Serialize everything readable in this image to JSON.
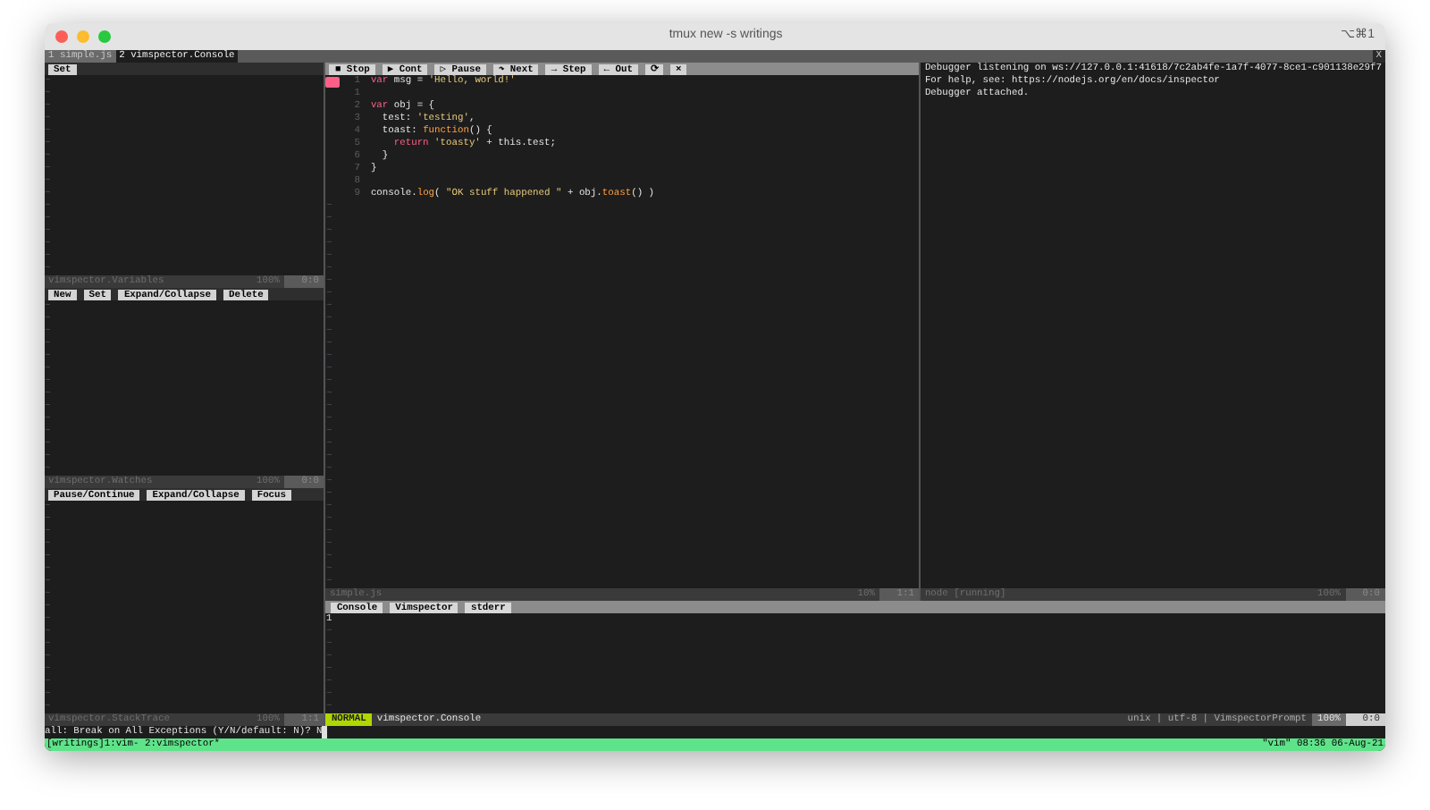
{
  "window": {
    "title": "tmux new -s writings",
    "shortcut": "⌥⌘1"
  },
  "vim_tabs": [
    {
      "label": "1 simple.js",
      "selected": false
    },
    {
      "label": "2 vimspector.Console",
      "selected": true
    }
  ],
  "tabline_close": "X",
  "left_panes": [
    {
      "toolbar": [
        "Set"
      ],
      "empty_lines": [
        "~",
        "~",
        "~",
        "~",
        "~",
        "~",
        "~",
        "~",
        "~",
        "~",
        "~",
        "~",
        "~",
        "~",
        "~",
        "~"
      ],
      "status": {
        "name": "vimspector.Variables",
        "percent": "100%",
        "position": "0:0"
      }
    },
    {
      "toolbar": [
        "New",
        "Set",
        "Expand/Collapse",
        "Delete"
      ],
      "empty_lines": [
        "~",
        "~",
        "~",
        "~",
        "~",
        "~",
        "~",
        "~",
        "~",
        "~",
        "~",
        "~",
        "~",
        "~"
      ],
      "status": {
        "name": "vimspector.Watches",
        "percent": "100%",
        "position": "0:0"
      }
    },
    {
      "toolbar": [
        "Pause/Continue",
        "Expand/Collapse",
        "Focus"
      ],
      "empty_lines": [
        "~",
        "~",
        "~",
        "~",
        "~",
        "~",
        "~",
        "~",
        "~",
        "~",
        "~",
        "~",
        "~",
        "~",
        "~",
        "~",
        "~"
      ],
      "status": {
        "name": "vimspector.StackTrace",
        "percent": "100%",
        "position": "1:1"
      }
    }
  ],
  "code_pane": {
    "toolbar": [
      "■ Stop",
      "▶ Cont",
      "▷ Pause",
      "↷ Next",
      "→ Step",
      "← Out",
      "⟳",
      "×"
    ],
    "lines": [
      {
        "number": "1",
        "current": true,
        "tokens": [
          {
            "kind": "keyword",
            "text": "var"
          },
          {
            "kind": "plain",
            "text": " msg = "
          },
          {
            "kind": "string",
            "text": "'Hello, world!'"
          }
        ]
      },
      {
        "number": "1",
        "current": false
      },
      {
        "number": "2",
        "current": false,
        "tokens": [
          {
            "kind": "keyword",
            "text": "var"
          },
          {
            "kind": "plain",
            "text": " obj = {"
          }
        ]
      },
      {
        "number": "3",
        "current": false,
        "tokens": [
          {
            "kind": "plain",
            "text": "  test: "
          },
          {
            "kind": "string",
            "text": "'testing'"
          },
          {
            "kind": "plain",
            "text": ","
          }
        ]
      },
      {
        "number": "4",
        "current": false,
        "tokens": [
          {
            "kind": "plain",
            "text": "  toast: "
          },
          {
            "kind": "function",
            "text": "function"
          },
          {
            "kind": "plain",
            "text": "() {"
          }
        ]
      },
      {
        "number": "5",
        "current": false,
        "tokens": [
          {
            "kind": "keyword",
            "text": "    return"
          },
          {
            "kind": "string",
            "text": " 'toasty'"
          },
          {
            "kind": "plain",
            "text": " + this.test;"
          }
        ]
      },
      {
        "number": "6",
        "current": false,
        "tokens": [
          {
            "kind": "plain",
            "text": "  }"
          }
        ]
      },
      {
        "number": "7",
        "current": false,
        "tokens": [
          {
            "kind": "plain",
            "text": "}"
          }
        ]
      },
      {
        "number": "8",
        "current": false
      },
      {
        "number": "9",
        "current": false,
        "tokens": [
          {
            "kind": "plain",
            "text": "console."
          },
          {
            "kind": "function",
            "text": "log"
          },
          {
            "kind": "plain",
            "text": "( "
          },
          {
            "kind": "string",
            "text": "\"OK stuff happened \""
          },
          {
            "kind": "plain",
            "text": " + obj."
          },
          {
            "kind": "function",
            "text": "toast"
          },
          {
            "kind": "plain",
            "text": "() )"
          }
        ]
      }
    ],
    "empty_lines": [
      "~",
      "~",
      "~",
      "~",
      "~",
      "~",
      "~",
      "~",
      "~",
      "~",
      "~",
      "~",
      "~",
      "~",
      "~",
      "~",
      "~",
      "~",
      "~",
      "~",
      "~",
      "~",
      "~",
      "~",
      "~",
      "~",
      "~",
      "~",
      "~",
      "~",
      "~"
    ],
    "status": {
      "name": "simple.js",
      "percent": "10%",
      "position": "1:1"
    }
  },
  "output_pane": {
    "lines": [
      "Debugger listening on ws://127.0.0.1:41618/7c2ab4fe-1a7f-4077-8ce1-c901138e29f7",
      "For help, see: https://nodejs.org/en/docs/inspector",
      "Debugger attached."
    ],
    "status": {
      "name": "node [running]",
      "percent": "100%",
      "position": "0:0"
    }
  },
  "console_pane": {
    "tabs": [
      "Console",
      "Vimspector",
      "stderr"
    ],
    "lines": [
      "1"
    ],
    "empty_lines": [
      "~",
      "~",
      "~",
      "~",
      "~",
      "~",
      "~"
    ],
    "status": {
      "mode": "NORMAL",
      "name": "vimspector.Console",
      "info": "unix | utf-8 | VimspectorPrompt",
      "percent": "100%",
      "position": "0:0"
    }
  },
  "command_line": "all: Break on All Exceptions (Y/N/default: N)? N",
  "tmux_status": {
    "left": "[writings]1:vim- 2:vimspector*",
    "right": "\"vim\" 08:36 06-Aug-21"
  }
}
